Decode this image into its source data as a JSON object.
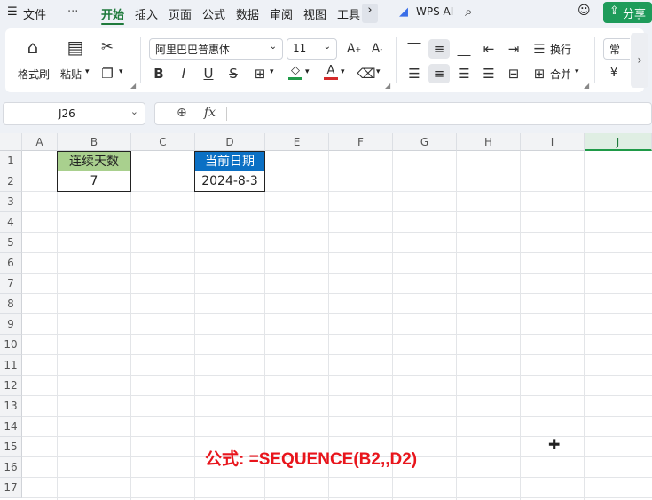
{
  "menu": {
    "hamburger_icon": "menu-icon",
    "file": "文件",
    "more": "···",
    "tabs": [
      "开始",
      "插入",
      "页面",
      "公式",
      "数据",
      "审阅",
      "视图",
      "工具"
    ],
    "wps_ai": "WPS AI",
    "share": "分享"
  },
  "ribbon": {
    "format_painter": "格式刷",
    "paste": "粘贴",
    "font_name": "阿里巴巴普惠体",
    "font_size": "11",
    "wrap": "换行",
    "merge": "合并",
    "number_format_partial": "常",
    "currency_symbol": "¥"
  },
  "formula_bar": {
    "name_box": "J26",
    "fx": "fx",
    "formula": ""
  },
  "grid": {
    "columns": [
      "A",
      "B",
      "C",
      "D",
      "E",
      "F",
      "G",
      "H",
      "I",
      "J"
    ],
    "selected_column": "J",
    "rows": [
      "1",
      "2",
      "3",
      "4",
      "5",
      "6",
      "7",
      "8",
      "9",
      "10",
      "11",
      "12",
      "13",
      "14",
      "15",
      "16",
      "17"
    ],
    "b1": "连续天数",
    "b2": "7",
    "d1": "当前日期",
    "d2": "2024-8-3",
    "header_green": "#a9d08e",
    "header_blue": "#0b70c4"
  },
  "annotation": "公式: =SEQUENCE(B2,,D2)"
}
